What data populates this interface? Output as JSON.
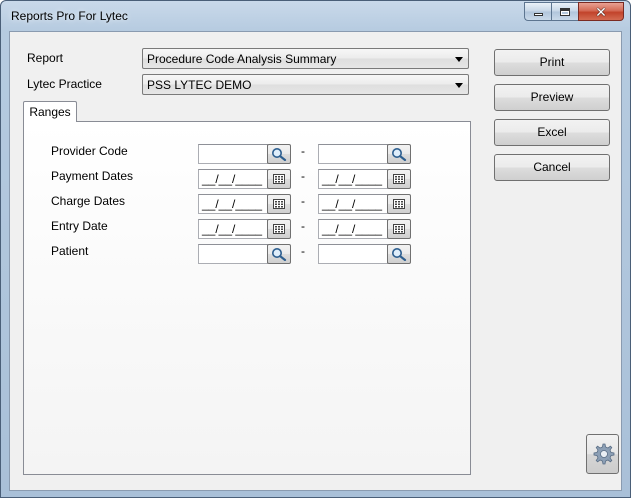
{
  "window": {
    "title": "Reports Pro For Lytec"
  },
  "form": {
    "report_label": "Report",
    "report_value": "Procedure Code Analysis Summary",
    "practice_label": "Lytec Practice",
    "practice_value": "PSS LYTEC DEMO"
  },
  "buttons": {
    "print": "Print",
    "preview": "Preview",
    "excel": "Excel",
    "cancel": "Cancel"
  },
  "tabs": {
    "ranges": "Ranges"
  },
  "ranges": {
    "separator": "-",
    "rows": [
      {
        "label": "Provider Code",
        "from": "",
        "to": "",
        "button": "search-icon"
      },
      {
        "label": "Payment Dates",
        "from": "__/__/____",
        "to": "__/__/____",
        "button": "calendar-icon"
      },
      {
        "label": "Charge Dates",
        "from": "__/__/____",
        "to": "__/__/____",
        "button": "calendar-icon"
      },
      {
        "label": "Entry Date",
        "from": "__/__/____",
        "to": "__/__/____",
        "button": "calendar-icon"
      },
      {
        "label": "Patient",
        "from": "",
        "to": "",
        "button": "search-icon"
      }
    ]
  }
}
